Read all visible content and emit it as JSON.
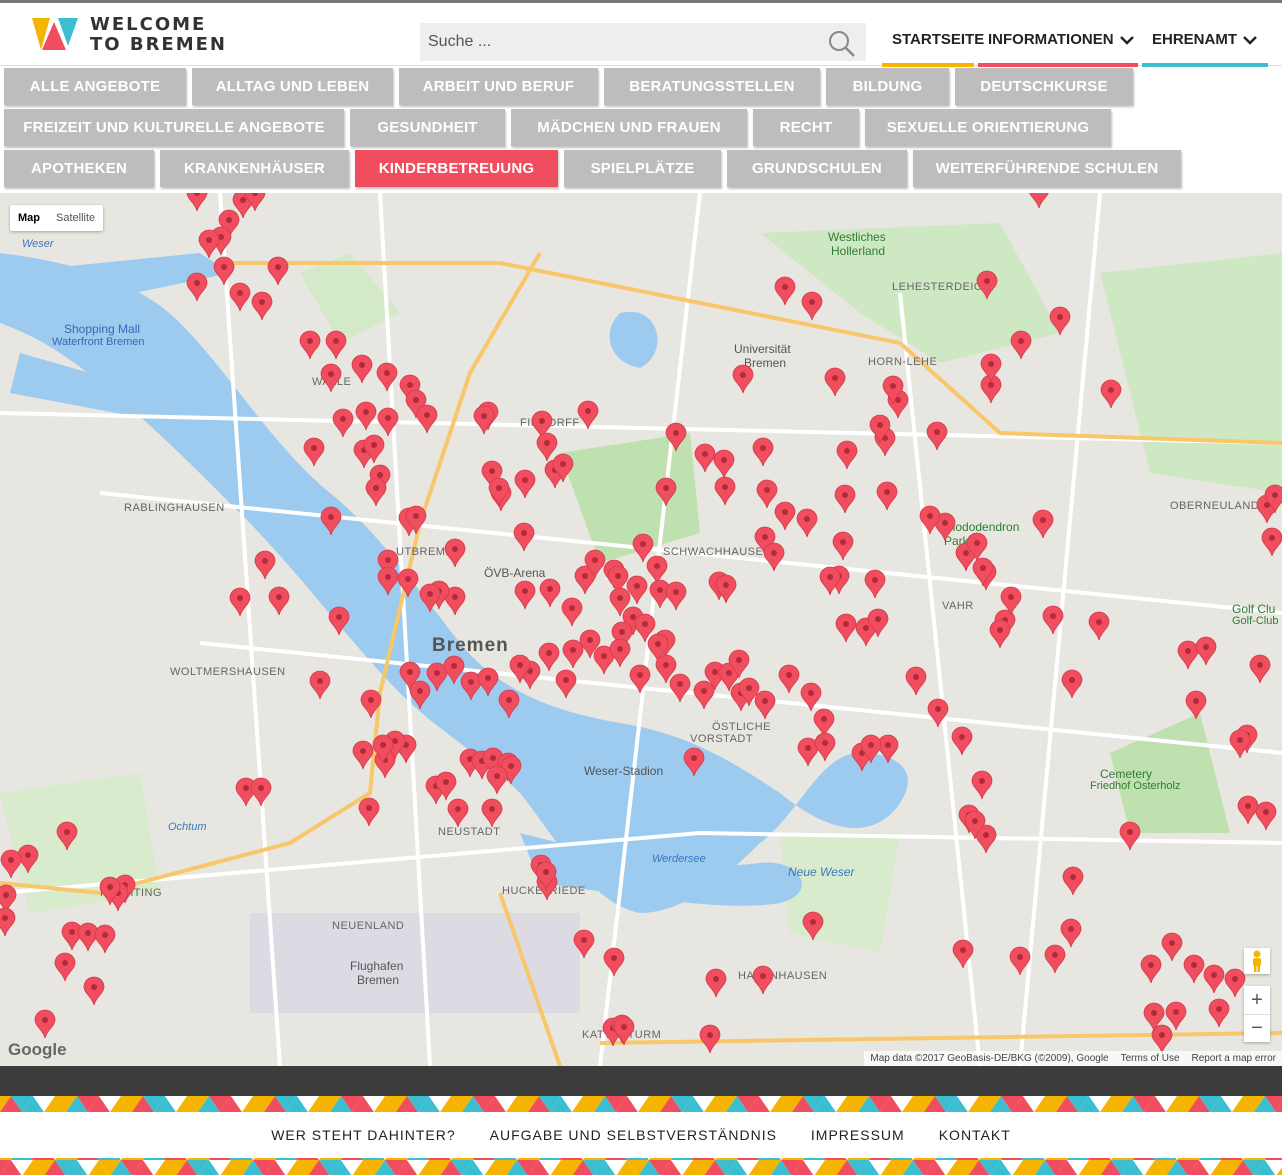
{
  "header": {
    "logo_line1": "WELCOME",
    "logo_line2": "TO BREMEN",
    "search_placeholder": "Suche ...",
    "nav": [
      {
        "label": "STARTSEITE",
        "color": "#f5b400"
      },
      {
        "label": "INFORMATIONEN",
        "color": "#f04e5e"
      },
      {
        "label": "EHRENAMT",
        "color": "#3bbfd0"
      }
    ]
  },
  "categories": {
    "row1": [
      "ALLE ANGEBOTE",
      "ALLTAG UND LEBEN",
      "ARBEIT UND BERUF",
      "BERATUNGSSTELLEN",
      "BILDUNG",
      "DEUTSCHKURSE"
    ],
    "row2": [
      "FREIZEIT UND KULTURELLE ANGEBOTE",
      "GESUNDHEIT",
      "MÄDCHEN UND FRAUEN",
      "RECHT",
      "SEXUELLE ORIENTIERUNG"
    ],
    "row3": [
      "APOTHEKEN",
      "KRANKENHÄUSER",
      "KINDERBETREUUNG",
      "SPIELPLÄTZE",
      "GRUNDSCHULEN",
      "WEITERFÜHRENDE SCHULEN"
    ],
    "active": "KINDERBETREUUNG",
    "active_color": "#f04e5e",
    "inactive_color": "#bdbdbd"
  },
  "map": {
    "toggle_map": "Map",
    "toggle_satellite": "Satellite",
    "city": "Bremen",
    "labels": {
      "shopping": "Shopping Mall",
      "waterfront": "Waterfront Bremen",
      "uni1": "Universität",
      "uni2": "Bremen",
      "hollerland1": "Westliches",
      "hollerland2": "Hollerland",
      "lehesterdeich": "LEHESTERDEICH",
      "hornlehe": "HORN-LEHE",
      "findorff": "FINDORFF",
      "rablinghausen": "RABLINGHAUSEN",
      "woltmershausen": "WOLTMERSHAUSEN",
      "schwachhausen": "SCHWACHHAUSEN",
      "vahr": "VAHR",
      "oberneuland": "OBERNEULAND",
      "oevb": "ÖVB-Arena",
      "weserstadion": "Weser-Stadion",
      "neuenland": "NEUENLAND",
      "flughafen1": "Flughafen",
      "flughafen2": "Bremen",
      "habenhausen": "HABENHAUSEN",
      "cemetery1": "Cemetery",
      "cemetery2": "Friedhof Osterholz",
      "golf1": "Golf Clu",
      "golf2": "Golf-Club",
      "neuewes": "Neue Weser",
      "werdersee": "Werdersee",
      "rhododendron1": "Rhododendron",
      "rhododendron2": "Park",
      "neustadt": "NEUSTADT",
      "huckelriede": "HUCKELRIEDE",
      "utbremen": "UTBREMEN",
      "oestliche1": "ÖSTLICHE",
      "oestliche2": "VORSTADT",
      "walle": "WALLE",
      "weser1": "Weser",
      "kattenturm": "KATTENTURM",
      "huchting": "HUCHTING",
      "ochtum": "Ochtum"
    },
    "google": "Google",
    "attribution": "Map data ©2017 GeoBasis-DE/BKG (©2009), Google",
    "terms": "Terms of Use",
    "report": "Report a map error",
    "zoom_in": "+",
    "zoom_out": "−",
    "marker_color": "#f04e5e"
  },
  "footer": {
    "links": [
      "WER STEHT DAHINTER?",
      "AUFGABE UND SELBSTVERSTÄNDNIS",
      "IMPRESSUM",
      "KONTAKT"
    ]
  }
}
